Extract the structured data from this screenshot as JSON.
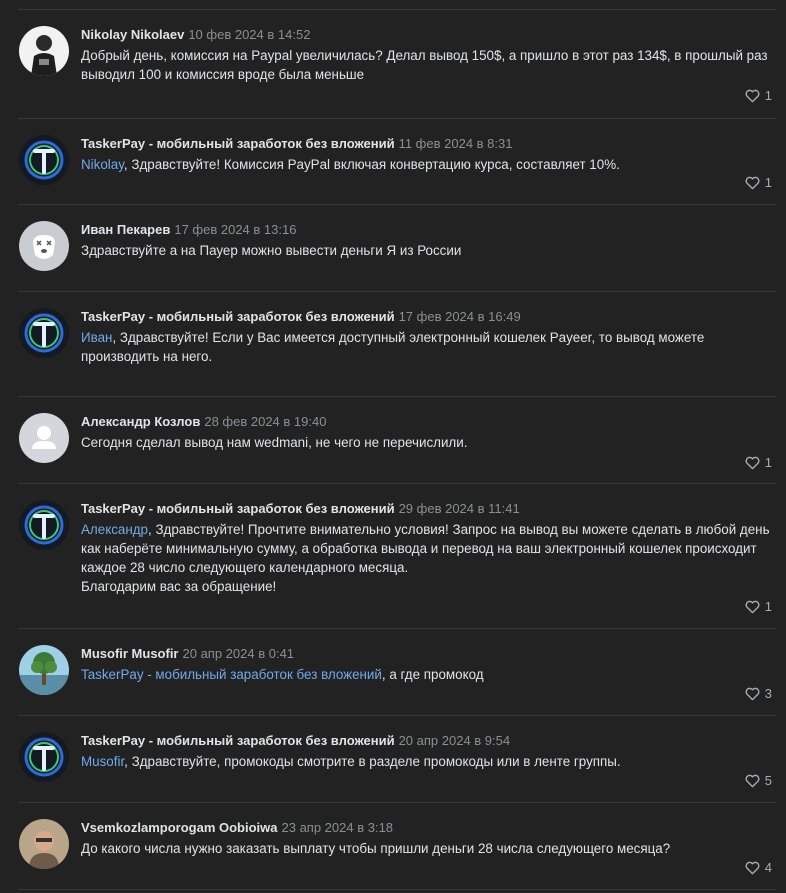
{
  "comments": [
    {
      "author": "Nikolay Nikolaev",
      "date": "10 фев 2024 в 14:52",
      "mention": "",
      "text": "Добрый день, комиссия на Paypal увеличилась? Делал вывод 150$, а пришло в этот раз 134$, в прошлый раз выводил 100 и комиссия вроде была меньше",
      "likes": "1",
      "avatar": "person-photo"
    },
    {
      "author": "TaskerPay - мобильный заработок без вложений",
      "date": "11 фев 2024 в 8:31",
      "mention": "Nikolay",
      "text": ", Здравствуйте! Комиссия PayPal включая конвертацию курса, составляет 10%.",
      "likes": "1",
      "avatar": "taskerpay-logo"
    },
    {
      "author": "Иван Пекарев",
      "date": "17 фев 2024 в 13:16",
      "mention": "",
      "text": "Здравствуйте а на Пауер можно вывести деньги Я из России",
      "likes": "",
      "avatar": "deactivated-dog"
    },
    {
      "author": "TaskerPay - мобильный заработок без вложений",
      "date": "17 фев 2024 в 16:49",
      "mention": "Иван",
      "text": ", Здравствуйте! Если у Вас имеется доступный электронный кошелек Payeer, то вывод можете производить на него.",
      "likes": "",
      "avatar": "taskerpay-logo"
    },
    {
      "author": "Александр Козлов",
      "date": "28 фев 2024 в 19:40",
      "mention": "",
      "text": "Сегодня сделал вывод нам wedmani, не чего не перечислили.",
      "likes": "1",
      "avatar": "default-user"
    },
    {
      "author": "TaskerPay - мобильный заработок без вложений",
      "date": "29 фев 2024 в 11:41",
      "mention": "Александр",
      "text": ", Здравствуйте! Прочтите внимательно условия! Запрос на вывод вы можете сделать в любой день как наберёте минимальную сумму, а обработка вывода и перевод на ваш электронный кошелек происходит каждое 28 число следующего календарного месяца.",
      "text2": "Благодарим вас за обращение!",
      "likes": "1",
      "avatar": "taskerpay-logo"
    },
    {
      "author": "Musofir Musofir",
      "date": "20 апр 2024 в 0:41",
      "mention": "TaskerPay - мобильный заработок без вложений",
      "text": ", а где промокод",
      "likes": "3",
      "avatar": "tree-photo"
    },
    {
      "author": "TaskerPay - мобильный заработок без вложений",
      "date": "20 апр 2024 в 9:54",
      "mention": "Musofir",
      "text": ", Здравствуйте, промокоды смотрите в разделе промокоды или в ленте группы.",
      "likes": "5",
      "avatar": "taskerpay-logo"
    },
    {
      "author": "Vsemkozlamporogam Oobioiwa",
      "date": "23 апр 2024 в 3:18",
      "mention": "",
      "text": "До какого числа нужно заказать выплату чтобы пришли деньги 28 числа следующего месяца?",
      "likes": "4",
      "avatar": "person-photo-2"
    }
  ],
  "icons": {
    "like": "heart-outline-icon"
  },
  "colors": {
    "background": "#222222",
    "link": "#71aaeb",
    "date": "#8b8f94"
  }
}
